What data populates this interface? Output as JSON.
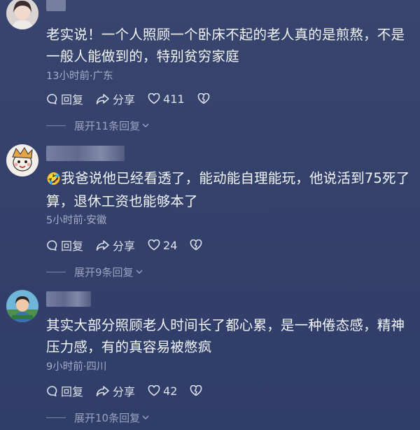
{
  "comments": [
    {
      "text": "老实说！一个人照顾一个卧床不起的老人真的是煎熬，不是一般人能做到的，特别贫穷家庭",
      "meta": "13小时前·广东",
      "reply_label": "回复",
      "share_label": "分享",
      "likes": "411",
      "expand_label": "展开11条回复"
    },
    {
      "emoji": "🤣",
      "text": "我爸说他已经看透了，能动能自理能玩，他说活到75死了算，退休工资也能够本了",
      "meta": "5小时前·安徽",
      "reply_label": "回复",
      "share_label": "分享",
      "likes": "24",
      "expand_label": "展开9条回复"
    },
    {
      "text": "其实大部分照顾老人时间长了都心累，是一种倦态感，精神压力感，有的真容易被憋疯",
      "meta": "9小时前·四川",
      "reply_label": "回复",
      "share_label": "分享",
      "likes": "42",
      "expand_label": "展开10条回复"
    }
  ]
}
